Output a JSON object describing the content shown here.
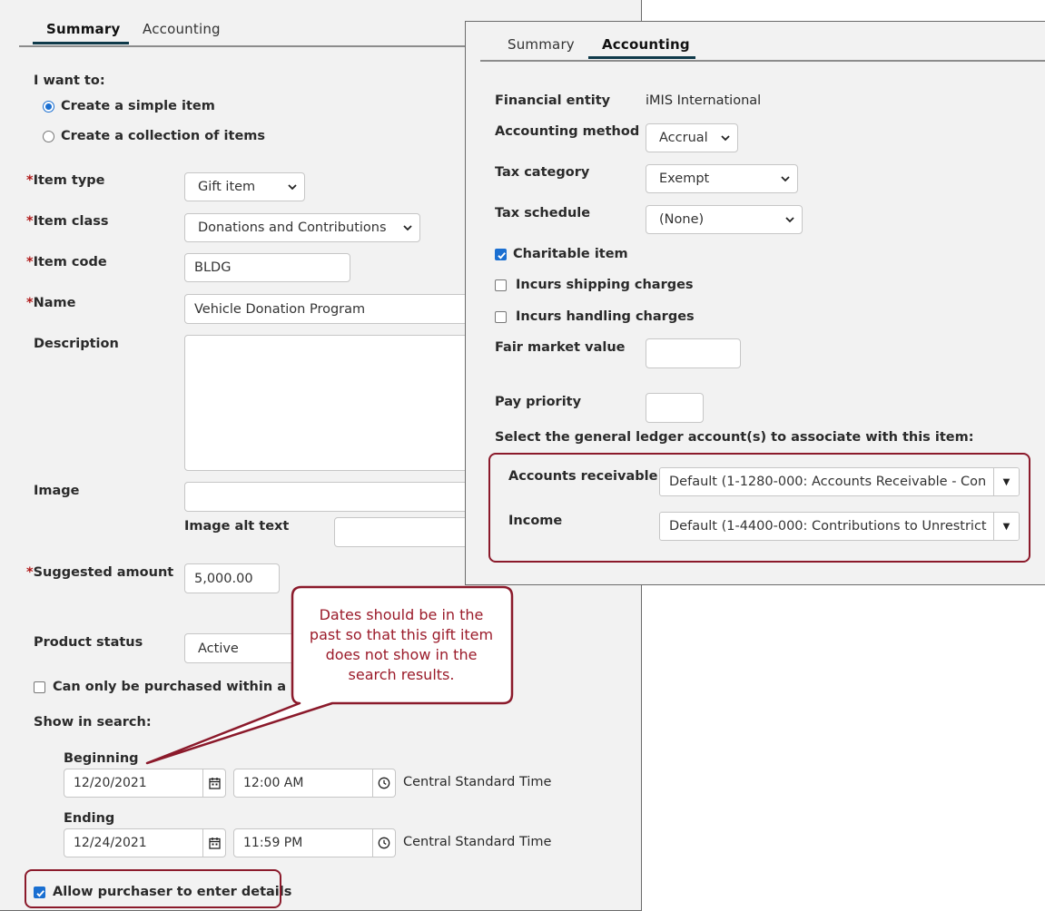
{
  "summary_panel": {
    "tabs": [
      {
        "label": "Summary",
        "active": true
      },
      {
        "label": "Accounting",
        "active": false
      }
    ],
    "i_want_to_label": "I want to:",
    "radio_options": [
      {
        "label": "Create a simple item",
        "selected": true
      },
      {
        "label": "Create a collection of items",
        "selected": false
      }
    ],
    "required_marker": "*",
    "item_type": {
      "label": "Item type",
      "value": "Gift item"
    },
    "item_class": {
      "label": "Item class",
      "value": "Donations and Contributions"
    },
    "item_code": {
      "label": "Item code",
      "value": "BLDG"
    },
    "name": {
      "label": "Name",
      "value": "Vehicle Donation Program"
    },
    "description": {
      "label": "Description",
      "value": ""
    },
    "image": {
      "label": "Image",
      "value": ""
    },
    "image_alt_text": {
      "label": "Image alt text",
      "value": ""
    },
    "suggested_amount": {
      "label": "Suggested amount",
      "value": "5,000.00"
    },
    "product_status": {
      "label": "Product status",
      "value": "Active"
    },
    "can_only_be_purchased": {
      "label": "Can only be purchased within a",
      "checked": false
    },
    "show_in_search_label": "Show in search:",
    "beginning": {
      "label": "Beginning",
      "date": "12/20/2021",
      "time": "12:00 AM",
      "timezone": "Central Standard Time"
    },
    "ending": {
      "label": "Ending",
      "date": "12/24/2021",
      "time": "11:59 PM",
      "timezone": "Central Standard Time"
    },
    "allow_purchaser": {
      "label": "Allow purchaser to enter details",
      "checked": true
    }
  },
  "accounting_panel": {
    "tabs": [
      {
        "label": "Summary",
        "active": false
      },
      {
        "label": "Accounting",
        "active": true
      }
    ],
    "financial_entity": {
      "label": "Financial entity",
      "value": "iMIS International"
    },
    "accounting_method": {
      "label": "Accounting method",
      "value": "Accrual"
    },
    "tax_category": {
      "label": "Tax category",
      "value": "Exempt"
    },
    "tax_schedule": {
      "label": "Tax schedule",
      "value": "(None)"
    },
    "charitable_item": {
      "label": "Charitable item",
      "checked": true
    },
    "incurs_shipping": {
      "label": "Incurs shipping charges",
      "checked": false
    },
    "incurs_handling": {
      "label": "Incurs handling charges",
      "checked": false
    },
    "fair_market_value": {
      "label": "Fair market value",
      "value": ""
    },
    "pay_priority": {
      "label": "Pay priority",
      "value": ""
    },
    "gl_prompt": "Select the general ledger account(s) to associate with this item:",
    "accounts_receivable": {
      "label": "Accounts receivable",
      "value": "Default (1-1280-000: Accounts Receivable - Con"
    },
    "income": {
      "label": "Income",
      "value": "Default (1-4400-000: Contributions to Unrestrict"
    }
  },
  "callout": {
    "text": "Dates should be in the past so that this gift item does not show in the search results."
  },
  "colors": {
    "panel_bg": "#f2f2f2",
    "tab_underline": "#0f3a4a",
    "required": "#b01818",
    "highlight": "#8b1a2b",
    "checkbox_blue": "#1a6fd1"
  },
  "icons": {
    "select_chevron": "chevron-down-icon",
    "date": "calendar-icon",
    "time": "clock-icon",
    "gl_dropdown": "triangle-down-icon",
    "checkbox_check": "checkmark-icon"
  }
}
